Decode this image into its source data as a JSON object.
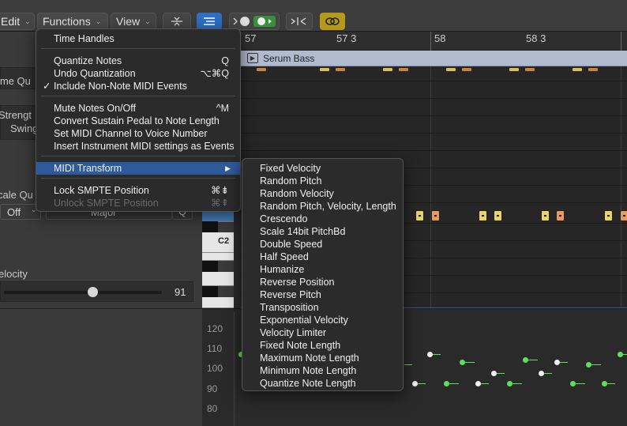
{
  "toolbar": {
    "edit_label": "Edit",
    "functions_label": "Functions",
    "view_label": "View",
    "chevron": "⌄"
  },
  "left_panel": {
    "time_quantize_label": "ime Qu",
    "strength_label": "Strengt",
    "swing_label": "Swing",
    "scale_quantize_label": "cale Qu",
    "scale_off_value": "Off",
    "scale_mode_value": "Major",
    "velocity_label": "elocity",
    "velocity_value": "91",
    "velocity_fraction": 0.56
  },
  "piano": {
    "c2_label": "C2"
  },
  "ruler": {
    "labels": [
      "57",
      "57 3",
      "58",
      "58 3"
    ]
  },
  "region": {
    "name": "Serum Bass"
  },
  "velocity_lane": {
    "ticks": [
      "120",
      "110",
      "100",
      "90",
      "80"
    ]
  },
  "functions_menu": {
    "items": [
      {
        "label": "Time Handles",
        "shortcut": ""
      },
      {
        "label": "Quantize Notes",
        "shortcut": "Q"
      },
      {
        "label": "Undo Quantization",
        "shortcut": "⌥⌘Q"
      },
      {
        "label": "Include Non-Note MIDI Events",
        "shortcut": "",
        "checked": "✓"
      },
      {
        "label": "Mute Notes On/Off",
        "shortcut": "^M"
      },
      {
        "label": "Convert Sustain Pedal to Note Length",
        "shortcut": ""
      },
      {
        "label": "Set MIDI Channel to Voice Number",
        "shortcut": ""
      },
      {
        "label": "Insert Instrument MIDI settings as Events",
        "shortcut": ""
      },
      {
        "label": "MIDI Transform",
        "shortcut": "",
        "arrow": "▶"
      },
      {
        "label": "Lock SMPTE Position",
        "shortcut": "⌘⇟"
      },
      {
        "label": "Unlock SMPTE Position",
        "shortcut": "⌘⇞"
      }
    ]
  },
  "transform_submenu": {
    "items": [
      "Fixed Velocity",
      "Random Pitch",
      "Random Velocity",
      "Random Pitch, Velocity, Length",
      "Crescendo",
      "Scale 14bit PitchBd",
      "Double Speed",
      "Half Speed",
      "Humanize",
      "Reverse Position",
      "Reverse Pitch",
      "Transposition",
      "Exponential Velocity",
      "Velocity Limiter",
      "Fixed Note Length",
      "Maximum Note Length",
      "Minimum Note Length",
      "Quantize Note Length"
    ]
  },
  "colors": {
    "accent": "#2e5a9c",
    "note_yellow": "#e8d36d",
    "note_orange": "#e89a5c",
    "velocity_green": "#5ee05e"
  }
}
